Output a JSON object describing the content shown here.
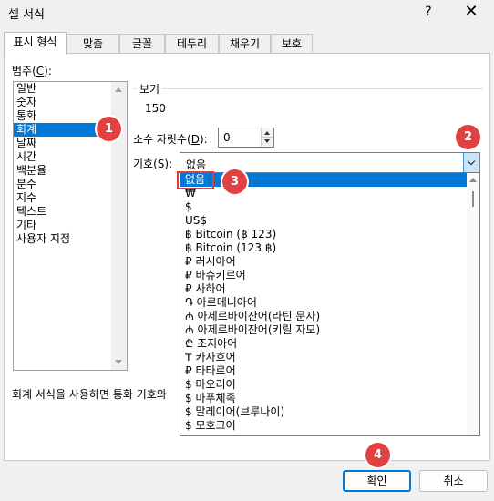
{
  "window": {
    "title": "셀 서식",
    "help_label": "?",
    "close_label": "✕"
  },
  "tabs": [
    {
      "label": "표시 형식",
      "active": true
    },
    {
      "label": "맞춤"
    },
    {
      "label": "글꼴"
    },
    {
      "label": "테두리"
    },
    {
      "label": "채우기"
    },
    {
      "label": "보호"
    }
  ],
  "category": {
    "label_text": "범주(",
    "label_key": "C",
    "label_end": "):",
    "items": [
      "일반",
      "숫자",
      "통화",
      "회계",
      "날짜",
      "시간",
      "백분율",
      "분수",
      "지수",
      "텍스트",
      "기타",
      "사용자 지정"
    ],
    "selected": "회계"
  },
  "sample": {
    "caption": "보기",
    "value": "150"
  },
  "decimal": {
    "label_text": "소수 자릿수(",
    "label_key": "D",
    "label_end": "):",
    "value": "0"
  },
  "symbol": {
    "label_text": "기호(",
    "label_key": "S",
    "label_end": "):",
    "value": "없음",
    "options": [
      "없음",
      "₩",
      "$",
      "US$",
      "฿ Bitcoin (฿ 123)",
      "฿ Bitcoin (123 ฿)",
      "₽ 러시아어",
      "₽ 바슈키르어",
      "₽ 사하어",
      "֏ 아르메니아어",
      "₼ 아제르바이잔어(라틴 문자)",
      "₼ 아제르바이잔어(키릴 자모)",
      "₾ 조지아어",
      "₸ 카자흐어",
      "₽ 타타르어",
      "$ 마오리어",
      "$ 마푸체족",
      "$ 말레이어(브루나이)",
      "$ 모호크어"
    ]
  },
  "description": "회계 서식을 사용하면 통화 기호와",
  "buttons": {
    "ok": "확인",
    "cancel": "취소"
  },
  "badges": [
    "1",
    "2",
    "3",
    "4"
  ],
  "colors": {
    "accent": "#0078d7",
    "badge": "#e04141",
    "highlight_box": "#e23b3b"
  }
}
